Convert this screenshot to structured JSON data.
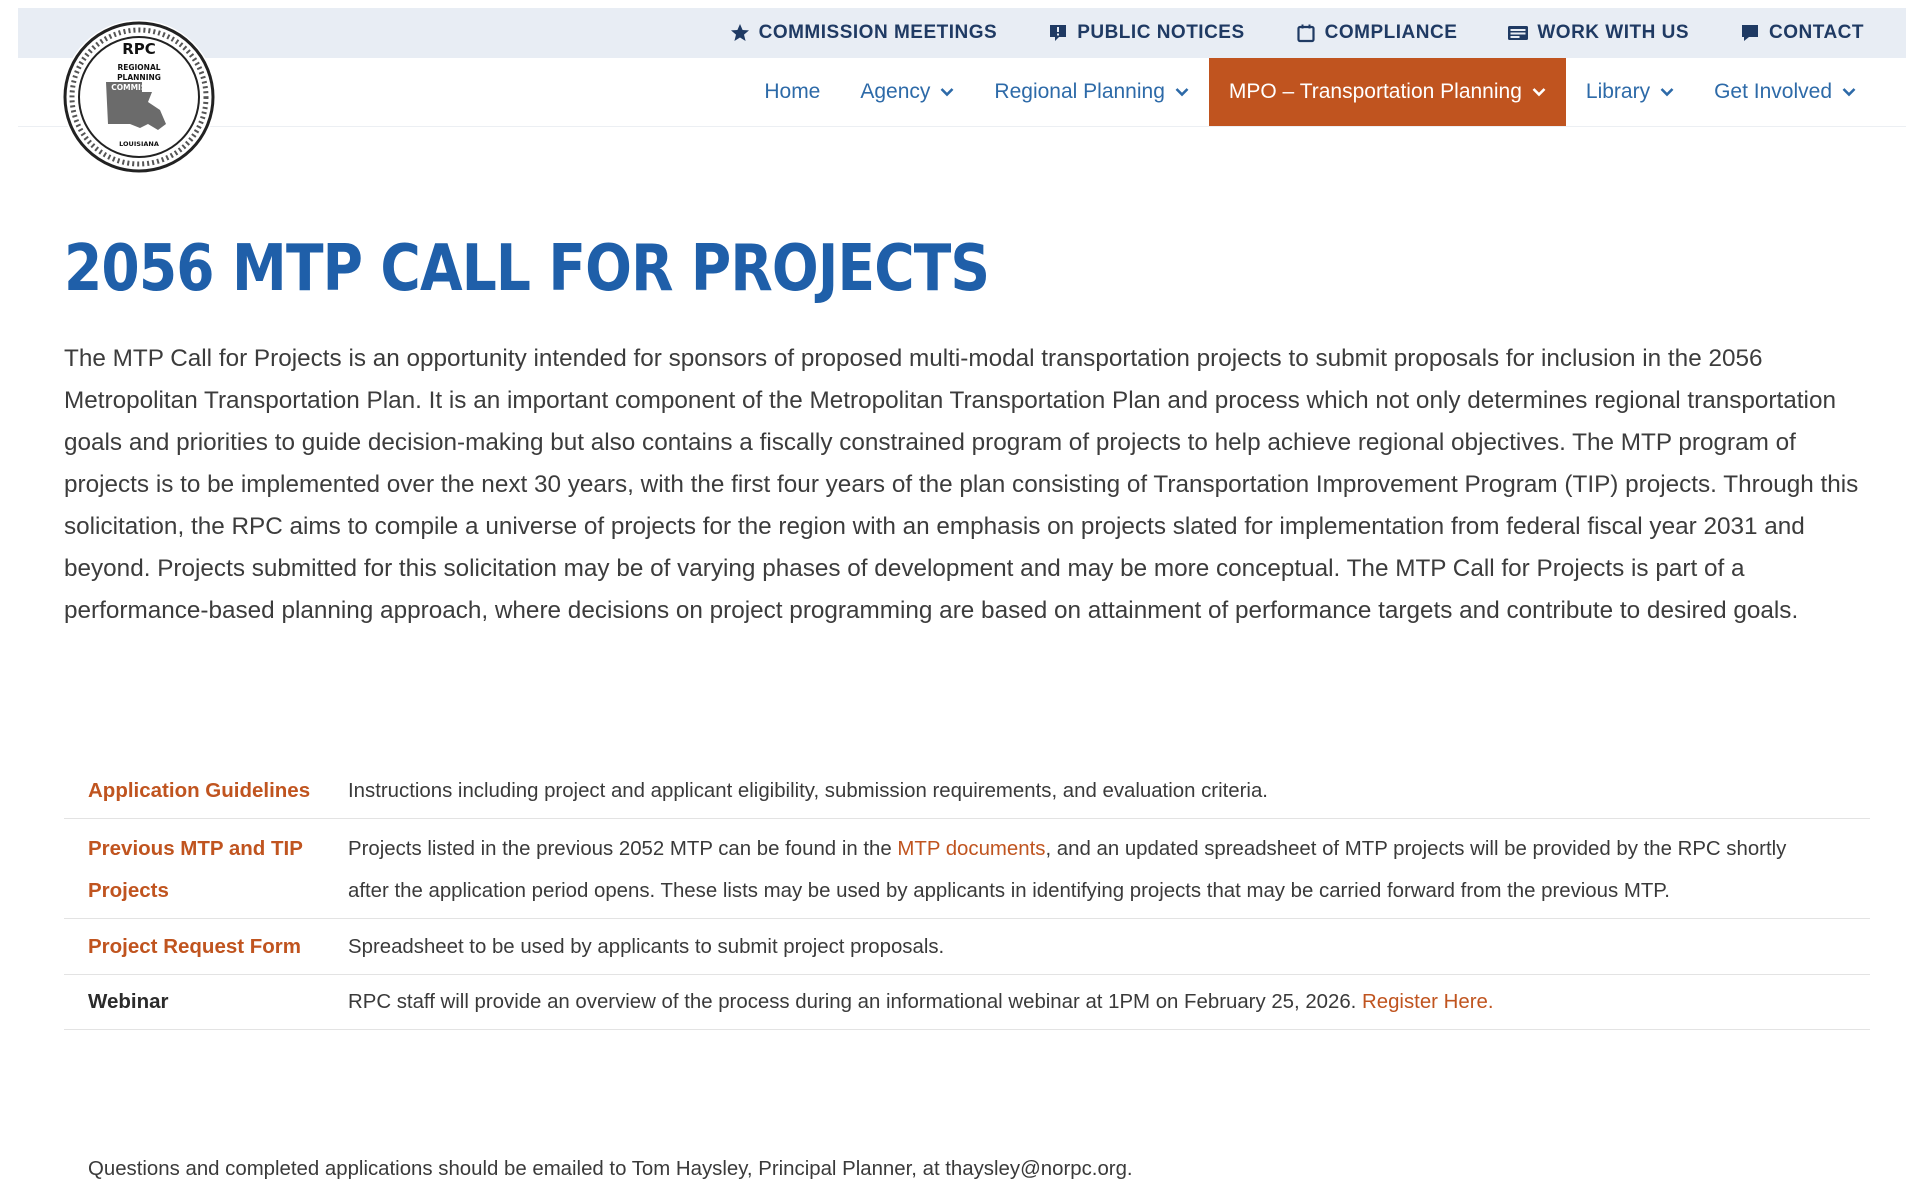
{
  "header": {
    "utility_links": [
      {
        "label": "COMMISSION MEETINGS",
        "icon": "star-icon"
      },
      {
        "label": "PUBLIC NOTICES",
        "icon": "megaphone-icon"
      },
      {
        "label": "COMPLIANCE",
        "icon": "calendar-icon"
      },
      {
        "label": "WORK WITH US",
        "icon": "id-card-icon"
      },
      {
        "label": "CONTACT",
        "icon": "chat-bubble-icon"
      }
    ],
    "logo": {
      "top_text": "RPC",
      "lines": [
        "REGIONAL",
        "PLANNING",
        "COMMISSION"
      ],
      "bottom_text": "LOUISIANA"
    },
    "nav": [
      {
        "label": "Home",
        "has_dropdown": false,
        "active": false
      },
      {
        "label": "Agency",
        "has_dropdown": true,
        "active": false
      },
      {
        "label": "Regional Planning",
        "has_dropdown": true,
        "active": false
      },
      {
        "label": "MPO – Transportation Planning",
        "has_dropdown": true,
        "active": true
      },
      {
        "label": "Library",
        "has_dropdown": true,
        "active": false
      },
      {
        "label": "Get Involved",
        "has_dropdown": true,
        "active": false
      }
    ],
    "colors": {
      "nav_text": "#2d6aa8",
      "active_bg": "#c0541f",
      "utility_bg": "#e8edf4",
      "utility_text": "#1f3a63"
    }
  },
  "main": {
    "title": "2056 MTP CALL FOR PROJECTS",
    "intro": "The MTP Call for Projects is an opportunity intended for sponsors of proposed multi-modal transportation projects to submit proposals for inclusion in the 2056 Metropolitan Transportation Plan. It is an important component of the Metropolitan Transportation Plan and process which not only determines regional transportation goals and priorities to guide decision-making but also contains a fiscally constrained program of projects to help achieve regional objectives. The MTP program of projects is to be implemented over the next 30 years, with the first four years of the plan consisting of Transportation Improvement Program (TIP) projects. Through this solicitation, the RPC aims to compile a universe of projects for the region with an emphasis on projects slated for implementation from federal fiscal year 2031 and beyond. Projects submitted for this solicitation may be of varying phases of development and may be more conceptual.  The MTP Call for Projects is part of a performance-based planning approach, where decisions on project programming are based on attainment of performance targets and contribute to desired goals.",
    "table": {
      "rows": [
        {
          "label": "Application Guidelines",
          "description": "Instructions including project and applicant eligibility, submission requirements, and evaluation criteria."
        },
        {
          "label": "Previous MTP and TIP Projects",
          "description_before": "Projects listed in the previous 2052 MTP can be found in the ",
          "link_text": "MTP documents",
          "description_after": ", and an updated spreadsheet of MTP projects will be provided by the RPC shortly after the application period opens. These lists may be used by applicants in identifying projects that may be carried forward from the previous MTP."
        },
        {
          "label": "Project Request Form",
          "description": "Spreadsheet to be used by applicants to submit project proposals."
        },
        {
          "label": "Webinar",
          "description_before": "RPC staff will provide an overview of the process during an informational webinar at 1PM on February 25, 2026. ",
          "link_text": "Register Here."
        }
      ]
    },
    "contact_line": "Questions and completed applications should be emailed to Tom Haysley, Principal Planner, at thaysley@norpc.org."
  }
}
